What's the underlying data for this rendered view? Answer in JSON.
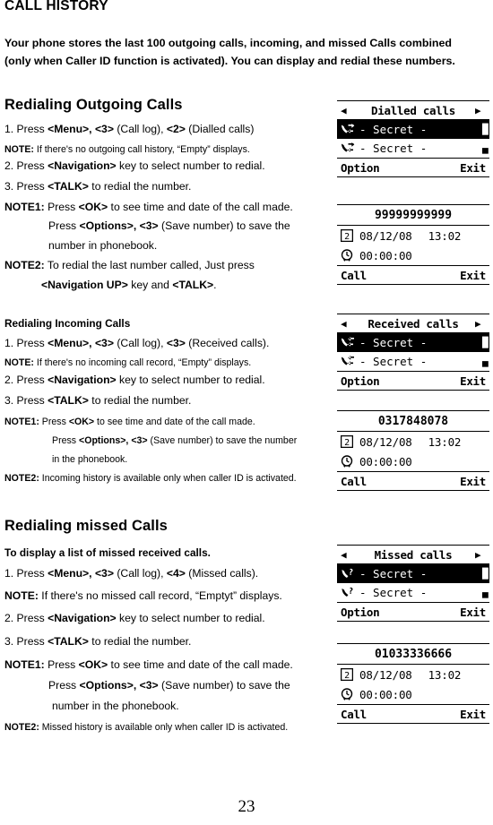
{
  "document": {
    "title": "CALL HISTORY",
    "intro_line1": "Your phone stores the last 100 outgoing calls, incoming, and missed Calls combined",
    "intro_line2": "(only when Caller ID function is activated). You can display and redial these numbers.",
    "page_number": "23"
  },
  "sections": {
    "outgoing": {
      "heading": "Redialing Outgoing Calls",
      "steps": [
        "1. Press <Menu>, <3> (Call log), <2> (Dialled calls)",
        "NOTE: If there's no outgoing call history, “Empty” displays.",
        "2. Press <Navigation> key to select number to redial.",
        "3. Press <TALK> to redial the number.",
        "NOTE1: Press <OK> to see time and date of the call made.",
        "Press <Options>, <3> (Save number) to save the",
        "number in phonebook.",
        "NOTE2: To redial the last number called, Just press",
        "<Navigation UP> key and <TALK>."
      ]
    },
    "incoming": {
      "heading": "Redialing Incoming Calls",
      "steps": [
        "1. Press <Menu>, <3> (Call log), <3> (Received calls).",
        "NOTE: If there's no incoming call record, “Empty” displays.",
        "2. Press <Navigation> key to select number to redial.",
        "3. Press <TALK> to redial the number.",
        "NOTE1: Press <OK> to see time and date of the call made.",
        "Press <Options>, <3> (Save number) to save the number",
        "in the phonebook.",
        "NOTE2: Incoming history is available only when caller ID is activated."
      ]
    },
    "missed": {
      "heading": "Redialing missed Calls",
      "subheading": "To display a list of missed received calls.",
      "steps": [
        "1. Press <Menu>, <3> (Call log), <4> (Missed calls).",
        "NOTE: If there's no missed call record,  “Emptyt” displays.",
        "2. Press <Navigation> key to select number to redial.",
        "3. Press <TALK> to redial the number.",
        "NOTE1: Press <OK> to see time and date of the call made.",
        "Press <Options>, <3> (Save number) to save the",
        "number in the phonebook.",
        "NOTE2: Missed history is available only when caller ID is activated."
      ]
    }
  },
  "screens": {
    "dialled_list": {
      "title": "Dialled calls",
      "arrow_left": "◀",
      "arrow_right": "▶",
      "items": [
        {
          "label": "- Secret -",
          "icon": "outgoing-call-icon",
          "selected": true
        },
        {
          "label": "- Secret -",
          "icon": "outgoing-call-icon",
          "selected": false
        }
      ],
      "softkey_left": "Option",
      "softkey_right": "Exit"
    },
    "dialled_detail": {
      "number": "99999999999",
      "date": "08/12/08",
      "time": "13:02",
      "duration": "00:00:00",
      "softkey_left": "Call",
      "softkey_right": "Exit"
    },
    "received_list": {
      "title": "Received calls",
      "arrow_left": "◀",
      "arrow_right": "▶",
      "items": [
        {
          "label": "- Secret -",
          "icon": "incoming-call-icon",
          "selected": true
        },
        {
          "label": "- Secret -",
          "icon": "incoming-call-icon",
          "selected": false
        }
      ],
      "softkey_left": "Option",
      "softkey_right": "Exit"
    },
    "received_detail": {
      "number": "0317848078",
      "date": "08/12/08",
      "time": "13:02",
      "duration": "00:00:00",
      "softkey_left": "Call",
      "softkey_right": "Exit"
    },
    "missed_list": {
      "title": "Missed calls",
      "arrow_left": "◀",
      "arrow_right": "▶",
      "items": [
        {
          "label": "- Secret -",
          "icon": "missed-call-icon",
          "selected": true
        },
        {
          "label": "- Secret -",
          "icon": "missed-call-icon",
          "selected": false
        }
      ],
      "softkey_left": "Option",
      "softkey_right": "Exit"
    },
    "missed_detail": {
      "number": "01033336666",
      "date": "08/12/08",
      "time": "13:02",
      "duration": "00:00:00",
      "softkey_left": "Call",
      "softkey_right": "Exit"
    }
  }
}
